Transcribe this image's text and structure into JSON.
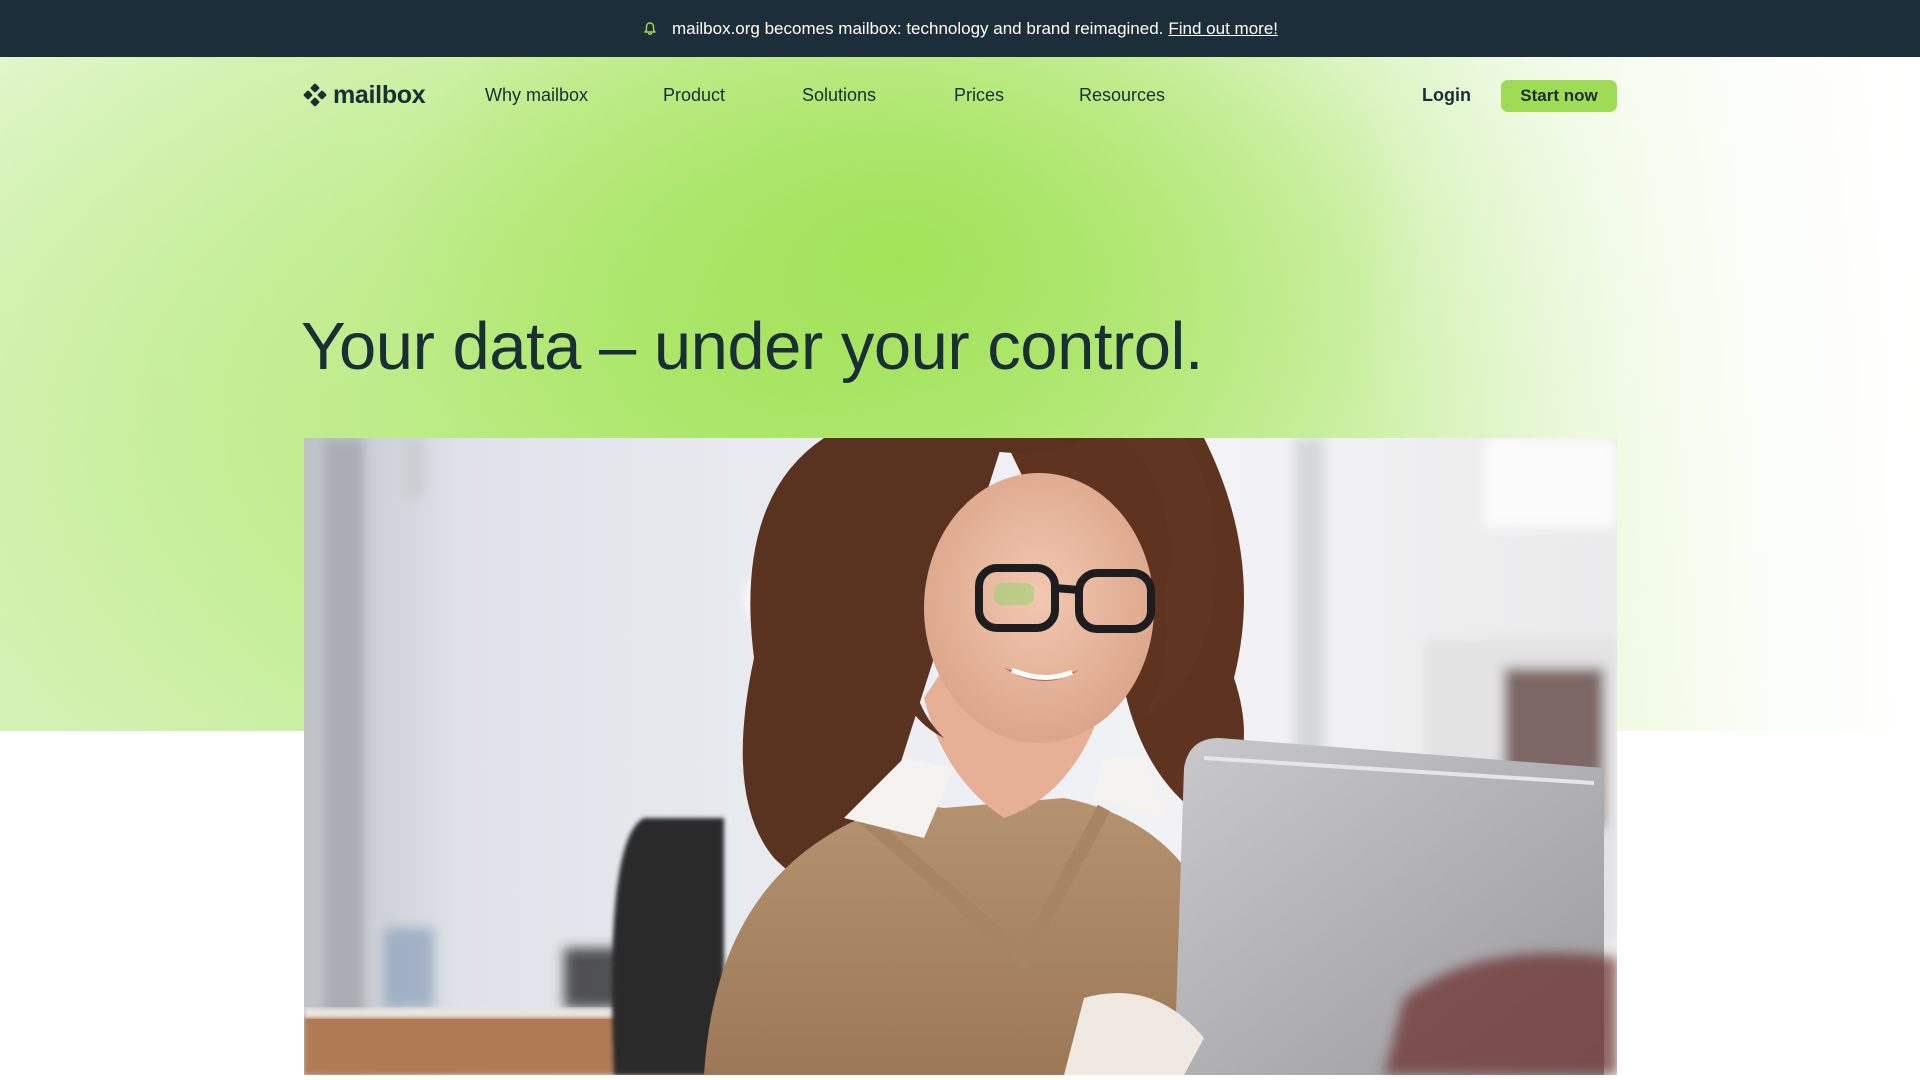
{
  "announcement": {
    "text": "mailbox.org becomes mailbox: technology and brand reimagined.",
    "link_label": "Find out more!",
    "icon": "bell-icon"
  },
  "header": {
    "logo_text": "mailbox",
    "nav": [
      {
        "label": "Why mailbox"
      },
      {
        "label": "Product"
      },
      {
        "label": "Solutions"
      },
      {
        "label": "Prices"
      },
      {
        "label": "Resources"
      }
    ],
    "login_label": "Login",
    "cta_label": "Start now"
  },
  "hero": {
    "headline": "Your data – under your control.",
    "image": "woman-at-laptop-photo"
  },
  "colors": {
    "brand_dark": "#1b2e3a",
    "text": "#1a2e35",
    "accent_green": "#9fdc55",
    "hero_green": "#b0e870"
  }
}
